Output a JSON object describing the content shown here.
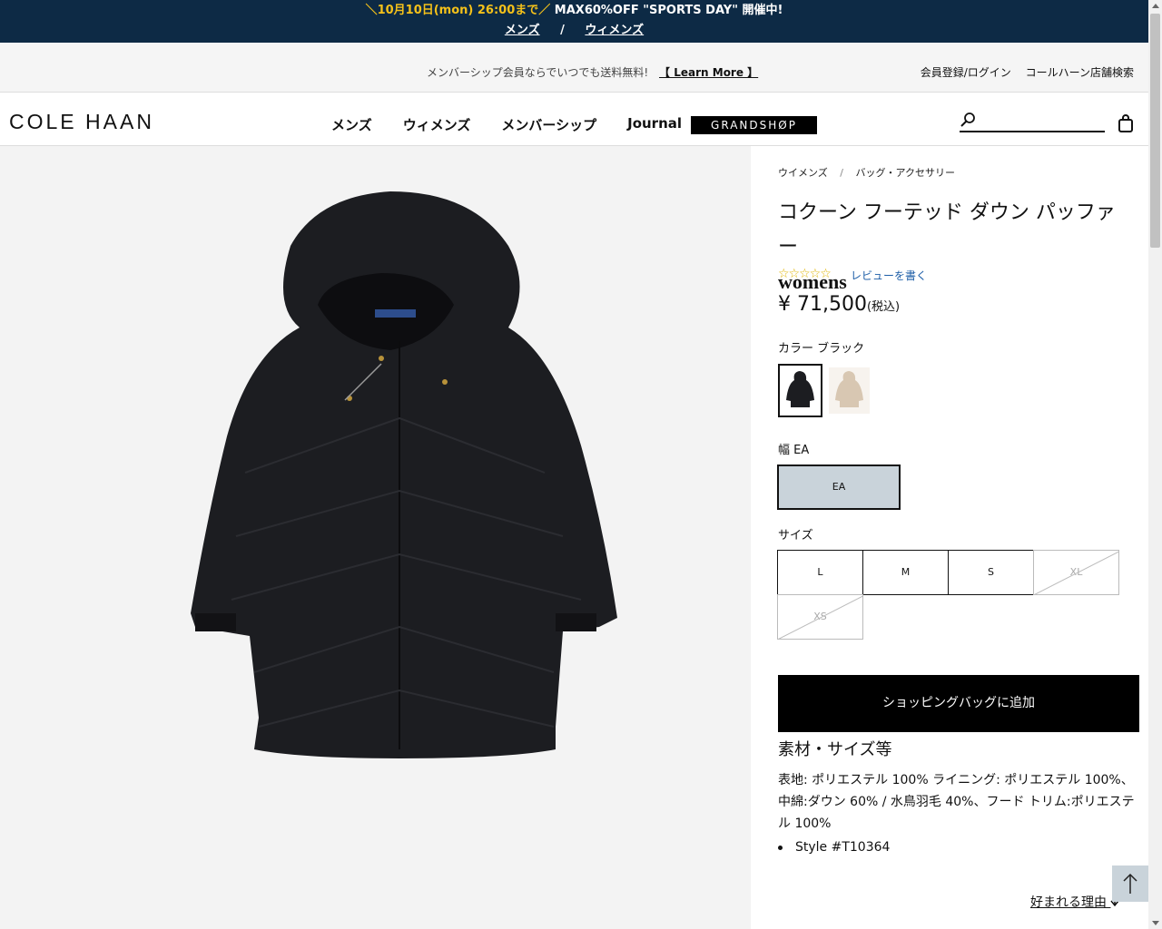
{
  "promo": {
    "line1_highlight": "＼10月10日(mon) 26:00まで／",
    "line1_rest": "MAX60%OFF \"SPORTS DAY\" 開催中!",
    "link_men": "メンズ",
    "separator": "/",
    "link_women": "ウィメンズ"
  },
  "utility": {
    "message": "メンバーシップ会員ならでいつでも送料無料!",
    "learn_more": "【 Learn More 】",
    "login": "会員登録/ログイン",
    "stores": "コールハーン店舗検索"
  },
  "nav": {
    "logo": "COLE HAAN",
    "items": [
      "メンズ",
      "ウィメンズ",
      "メンバーシップ",
      "Journal"
    ],
    "grandshop": "GRANDSHØP"
  },
  "product": {
    "breadcrumb": [
      "ウイメンズ",
      "バッグ・アクセサリー"
    ],
    "breadcrumb_sep": "/",
    "title_jp": "コクーン フーテッド ダウン パッファー",
    "title_en": "womens",
    "stars": "☆☆☆☆☆",
    "review_link": "レビューを書く",
    "price": "¥ 71,500",
    "tax_note": "(税込)",
    "color_label": "カラー ブラック",
    "width_label": "幅 EA",
    "width_option": "EA",
    "size_label": "サイズ",
    "sizes": [
      "L",
      "M",
      "S",
      "XL",
      "XS"
    ],
    "unavailable_sizes": [
      "XL",
      "XS"
    ],
    "add_to_bag": "ショッピングバッグに追加",
    "materials_heading": "素材・サイズ等",
    "materials_text": "表地: ポリエステル 100% ライニング: ポリエステル 100%、中綿:ダウン 60% / 水鳥羽毛 40%、フード トリム:ポリエステル 100%",
    "style_number": "Style #T10364",
    "why_link": "好まれる理由"
  },
  "colors": {
    "promo_bg": "#0d2a45",
    "promo_highlight": "#f4c11a",
    "width_selected_bg": "#c9d3da",
    "link": "#1f5fa8"
  }
}
